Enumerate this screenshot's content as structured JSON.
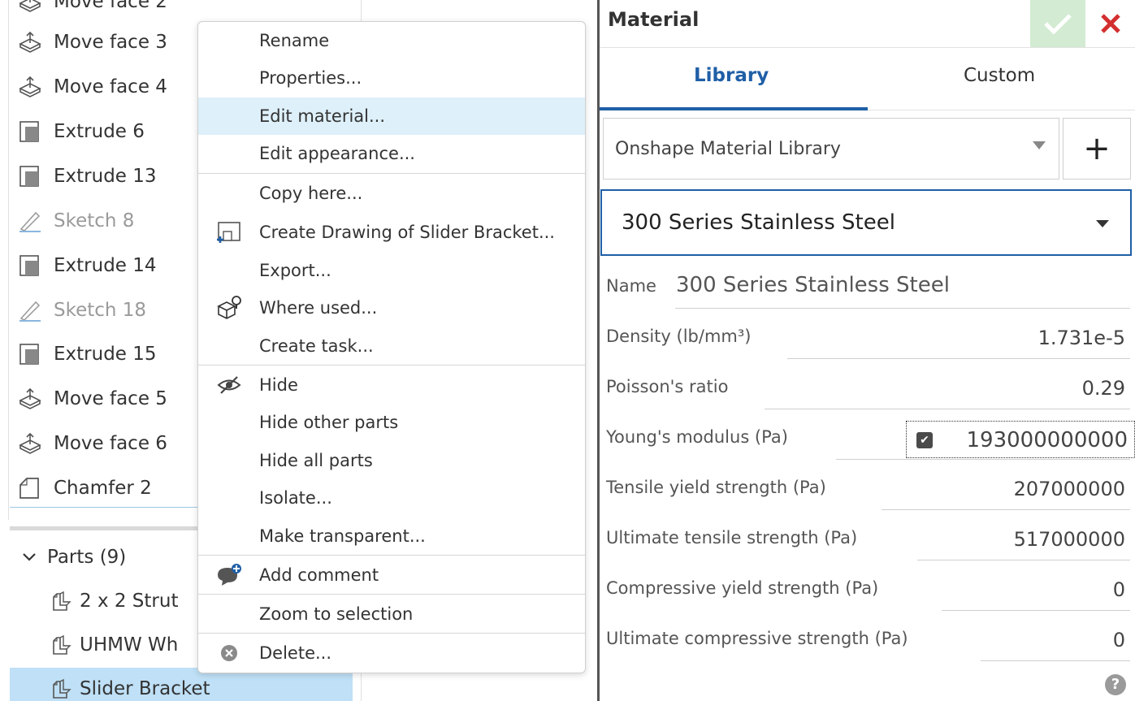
{
  "feature_tree": {
    "items": [
      {
        "label": "Move face 2",
        "icon": "move-face-icon",
        "dim": false
      },
      {
        "label": "Move face 3",
        "icon": "move-face-icon",
        "dim": false
      },
      {
        "label": "Move face 4",
        "icon": "move-face-icon",
        "dim": false
      },
      {
        "label": "Extrude 6",
        "icon": "extrude-icon",
        "dim": false
      },
      {
        "label": "Extrude 13",
        "icon": "extrude-icon",
        "dim": false
      },
      {
        "label": "Sketch 8",
        "icon": "sketch-icon",
        "dim": true
      },
      {
        "label": "Extrude 14",
        "icon": "extrude-icon",
        "dim": false
      },
      {
        "label": "Sketch 18",
        "icon": "sketch-icon",
        "dim": true
      },
      {
        "label": "Extrude 15",
        "icon": "extrude-icon",
        "dim": false
      },
      {
        "label": "Move face 5",
        "icon": "move-face-icon",
        "dim": false
      },
      {
        "label": "Move face 6",
        "icon": "move-face-icon",
        "dim": false
      },
      {
        "label": "Chamfer 2",
        "icon": "chamfer-icon",
        "dim": false
      }
    ],
    "parts_header": "Parts (9)",
    "parts": [
      {
        "label": "2 x 2 Strut",
        "icon": "part-icon"
      },
      {
        "label": "UHMW Wh",
        "icon": "part-icon"
      },
      {
        "label": "Slider Bracket",
        "icon": "part-icon"
      }
    ]
  },
  "context_menu": {
    "items": [
      {
        "label": "Rename",
        "icon": ""
      },
      {
        "label": "Properties...",
        "icon": ""
      },
      {
        "label": "Edit material...",
        "icon": ""
      },
      {
        "label": "Edit appearance...",
        "icon": ""
      },
      {
        "label": "Copy here...",
        "icon": ""
      },
      {
        "label": "Create Drawing of Slider Bracket...",
        "icon": "create-drawing-icon"
      },
      {
        "label": "Export...",
        "icon": ""
      },
      {
        "label": "Where used...",
        "icon": "where-used-icon"
      },
      {
        "label": "Create task...",
        "icon": ""
      },
      {
        "label": "Hide",
        "icon": "hide-icon"
      },
      {
        "label": "Hide other parts",
        "icon": ""
      },
      {
        "label": "Hide all parts",
        "icon": ""
      },
      {
        "label": "Isolate...",
        "icon": ""
      },
      {
        "label": "Make transparent...",
        "icon": ""
      },
      {
        "label": "Add comment",
        "icon": "comment-icon"
      },
      {
        "label": "Zoom to selection",
        "icon": ""
      },
      {
        "label": "Delete...",
        "icon": "delete-icon"
      }
    ],
    "highlighted": "Edit material..."
  },
  "material_panel": {
    "title": "Material",
    "tabs": {
      "library": "Library",
      "custom": "Custom"
    },
    "library_select": "Onshape Material Library",
    "add_label": "+",
    "material_select": "300 Series Stainless Steel",
    "name_label": "Name",
    "name_value": "300 Series Stainless Steel",
    "properties": [
      {
        "label": "Density (lb/mm³)",
        "value": "1.731e-5"
      },
      {
        "label": "Poisson's ratio",
        "value": "0.29"
      },
      {
        "label": "Young's modulus (Pa)",
        "value": "193000000000"
      },
      {
        "label": "Tensile yield strength (Pa)",
        "value": "207000000"
      },
      {
        "label": "Ultimate tensile strength (Pa)",
        "value": "517000000"
      },
      {
        "label": "Compressive yield strength (Pa)",
        "value": "0"
      },
      {
        "label": "Ultimate compressive strength (Pa)",
        "value": "0"
      }
    ],
    "help": "?",
    "colors": {
      "accent": "#1f5fa6",
      "ok_bg": "#d2ebd2",
      "ok_check": "#ffffff",
      "cancel_x": "#d32f2f",
      "highlight": "#def0f9",
      "selected": "#bfe0f6"
    }
  }
}
